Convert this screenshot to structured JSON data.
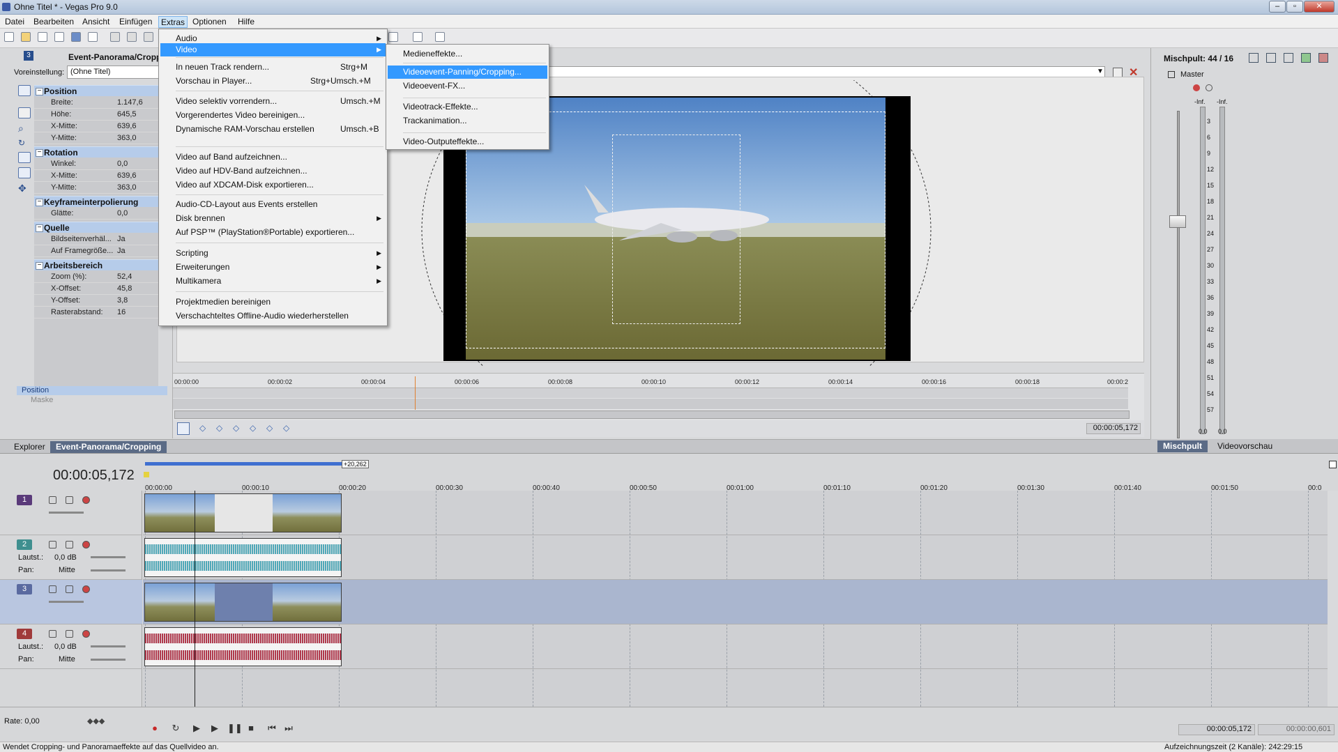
{
  "window": {
    "title": "Ohne Titel * - Vegas Pro 9.0"
  },
  "menubar": [
    "Datei",
    "Bearbeiten",
    "Ansicht",
    "Einfügen",
    "Extras",
    "Optionen",
    "Hilfe"
  ],
  "extras_menu": [
    {
      "label": "Audio",
      "submenu": true
    },
    {
      "label": "Video",
      "submenu": true,
      "highlighted": true
    },
    {
      "label": "In neuen Track rendern...",
      "shortcut": "Strg+M"
    },
    {
      "label": "Vorschau in Player...",
      "shortcut": "Strg+Umsch.+M"
    },
    {
      "label": "Video selektiv vorrendern...",
      "shortcut": "Umsch.+M"
    },
    {
      "label": "Vorgerendertes Video bereinigen..."
    },
    {
      "label": "Dynamische RAM-Vorschau erstellen",
      "shortcut": "Umsch.+B"
    },
    {
      "label": "Video auf Band aufzeichnen..."
    },
    {
      "label": "Video auf HDV-Band aufzeichnen..."
    },
    {
      "label": "Video auf XDCAM-Disk exportieren..."
    },
    {
      "label": "Audio-CD-Layout aus Events erstellen"
    },
    {
      "label": "Disk brennen",
      "submenu": true
    },
    {
      "label": "Auf PSP™ (PlayStation®Portable) exportieren..."
    },
    {
      "label": "Scripting",
      "submenu": true
    },
    {
      "label": "Erweiterungen",
      "submenu": true
    },
    {
      "label": "Multikamera",
      "submenu": true
    },
    {
      "label": "Projektmedien bereinigen"
    },
    {
      "label": "Verschachteltes Offline-Audio wiederherstellen"
    }
  ],
  "video_submenu": [
    {
      "label": "Medieneffekte..."
    },
    {
      "label": "Videoevent-Panning/Cropping...",
      "highlighted": true
    },
    {
      "label": "Videoevent-FX..."
    },
    {
      "label": "Videotrack-Effekte..."
    },
    {
      "label": "Trackanimation..."
    },
    {
      "label": "Video-Outputeffekte..."
    }
  ],
  "pancrop": {
    "title": "Event-Panorama/Cropp",
    "event_number": "3",
    "preset_label": "Voreinstellung:",
    "preset_value": "(Ohne Titel)",
    "sections": {
      "position": "Position",
      "rotation": "Rotation",
      "keyframe": "Keyframeinterpolierung",
      "quelle": "Quelle",
      "arbeitsbereich": "Arbeitsbereich"
    },
    "rows": [
      {
        "k": "Breite:",
        "v": "1.147,6"
      },
      {
        "k": "Höhe:",
        "v": "645,5"
      },
      {
        "k": "X-Mitte:",
        "v": "639,6"
      },
      {
        "k": "Y-Mitte:",
        "v": "363,0"
      },
      {
        "k": "Winkel:",
        "v": "0,0"
      },
      {
        "k": "X-Mitte:",
        "v": "639,6"
      },
      {
        "k": "Y-Mitte:",
        "v": "363,0"
      },
      {
        "k": "Glätte:",
        "v": "0,0"
      },
      {
        "k": "Bildseitenverhäl...",
        "v": "Ja"
      },
      {
        "k": "Auf Framegröße...",
        "v": "Ja"
      },
      {
        "k": "Zoom (%):",
        "v": "52,4"
      },
      {
        "k": "X-Offset:",
        "v": "45,8"
      },
      {
        "k": "Y-Offset:",
        "v": "3,8"
      },
      {
        "k": "Rasterabstand:",
        "v": "16"
      }
    ],
    "lane_position": "Position",
    "lane_mask": "Maske",
    "timeline_ticks": [
      "00:00:00",
      "00:00:02",
      "00:00:04",
      "00:00:06",
      "00:00:08",
      "00:00:10",
      "00:00:12",
      "00:00:14",
      "00:00:16",
      "00:00:18",
      "00:00:2"
    ],
    "time": "00:00:05,172"
  },
  "tabs": {
    "explorer": "Explorer",
    "pancrop": "Event-Panorama/Cropping",
    "mixer": "Mischpult",
    "videopreview": "Videovorschau"
  },
  "mixer": {
    "title": "Mischpult: 44 / 16",
    "master": "Master",
    "inf_l": "-Inf.",
    "inf_r": "-Inf.",
    "scale": [
      "3",
      "6",
      "9",
      "12",
      "15",
      "18",
      "21",
      "24",
      "27",
      "30",
      "33",
      "36",
      "39",
      "42",
      "45",
      "48",
      "51",
      "54",
      "57"
    ],
    "val_l": "0.0",
    "val_r": "0.0"
  },
  "timeline": {
    "time": "00:00:05,172",
    "loop_label": "+20,262",
    "ticks": [
      "00:00:00",
      "00:00:10",
      "00:00:20",
      "00:00:30",
      "00:00:40",
      "00:00:50",
      "00:01:00",
      "00:01:10",
      "00:01:20",
      "00:01:30",
      "00:01:40",
      "00:01:50",
      "00:0"
    ],
    "tracks": [
      {
        "num": "1",
        "type": "video",
        "color": "#5a3a7a"
      },
      {
        "num": "2",
        "type": "audio",
        "color": "#3f8f8f",
        "vol_label": "Lautst.:",
        "vol": "0,0 dB",
        "pan_label": "Pan:",
        "pan": "Mitte"
      },
      {
        "num": "3",
        "type": "video",
        "color": "#5a6aa0"
      },
      {
        "num": "4",
        "type": "audio",
        "color": "#a03a3a",
        "vol_label": "Lautst.:",
        "vol": "0,0 dB",
        "pan_label": "Pan:",
        "pan": "Mitte"
      }
    ]
  },
  "transport": {
    "rate": "Rate: 0,00",
    "time_cursor": "00:00:05,172",
    "time_end": "00:00:00,601"
  },
  "status": {
    "text": "Wendet Cropping- und Panoramaeffekte auf das Quellvideo an.",
    "record": "Aufzeichnungszeit (2 Kanäle): 242:29:15"
  }
}
